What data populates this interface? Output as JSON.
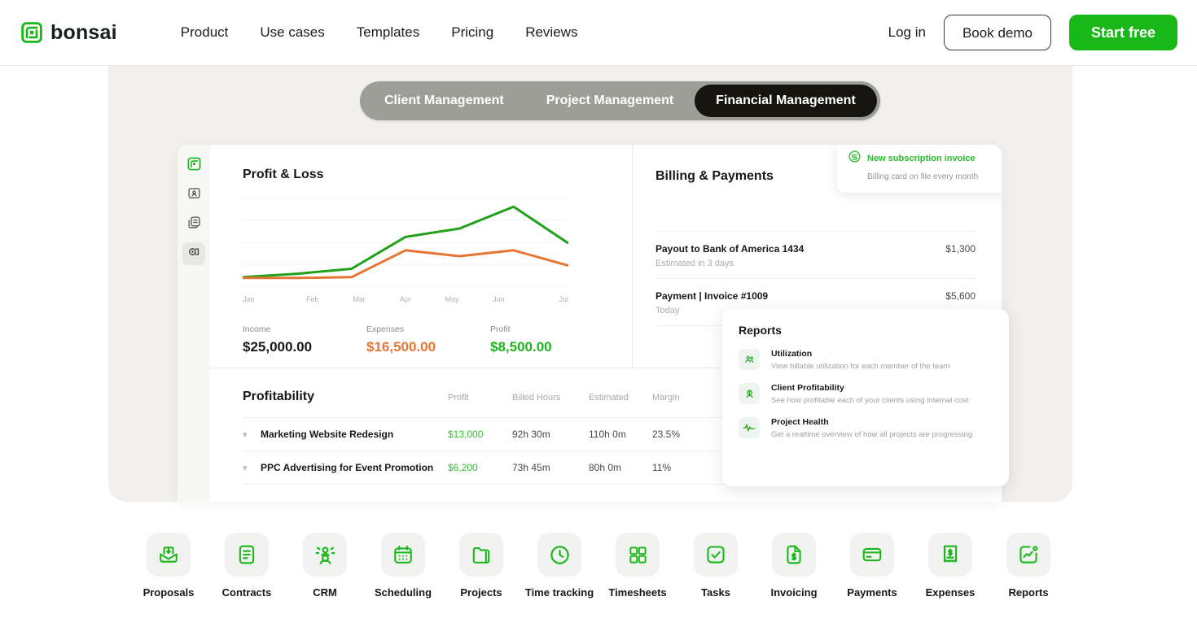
{
  "nav": {
    "brand": "bonsai",
    "brand_icon": "bonsai-square-spiral-logo",
    "links": [
      "Product",
      "Use cases",
      "Templates",
      "Pricing",
      "Reviews"
    ],
    "login": "Log in",
    "book_demo": "Book demo",
    "start_free": "Start free"
  },
  "tabs": [
    {
      "label": "Client Management",
      "active": false
    },
    {
      "label": "Project Management",
      "active": false
    },
    {
      "label": "Financial Management",
      "active": true
    }
  ],
  "rail": [
    {
      "icon": "bonsai-logo-icon",
      "selected": false
    },
    {
      "icon": "contact-card-icon",
      "selected": false
    },
    {
      "icon": "documents-icon",
      "selected": false
    },
    {
      "icon": "payments-icon",
      "selected": true
    }
  ],
  "profit_loss": {
    "title": "Profit & Loss",
    "stats": [
      {
        "label": "Income",
        "value": "$25,000.00",
        "color": "#18181a"
      },
      {
        "label": "Expenses",
        "value": "$16,500.00",
        "color": "#e87434"
      },
      {
        "label": "Profit",
        "value": "$8,500.00",
        "color": "#1db71d"
      }
    ]
  },
  "chart_data": {
    "type": "line",
    "title": "Profit & Loss",
    "xlabel": "",
    "ylabel": "",
    "grid": true,
    "legend_position": "none",
    "categories": [
      "Jan",
      "Feb",
      "Mar",
      "Apr",
      "May",
      "Jun",
      "Jul"
    ],
    "x": [
      0,
      1,
      2,
      3,
      4,
      5,
      6
    ],
    "ylim": [
      0,
      100
    ],
    "series": [
      {
        "name": "Income",
        "color": "#22a11a",
        "values": [
          8,
          12,
          18,
          56,
          66,
          92,
          49
        ]
      },
      {
        "name": "Expenses",
        "color": "#e87434",
        "values": [
          7,
          7,
          8,
          40,
          33,
          40,
          22
        ]
      }
    ]
  },
  "billing": {
    "title": "Billing & Payments",
    "subscription_card": {
      "icon": "subscription-refresh-icon",
      "title": "New subscription invoice",
      "subtitle": "Billing card on file every month"
    },
    "rows": [
      {
        "title": "Payout to Bank of America 1434",
        "subtitle": "Estimated in 3 days",
        "amount": "$1,300"
      },
      {
        "title": "Payment  |  Invoice #1009",
        "subtitle": "Today",
        "amount": "$5,600"
      }
    ]
  },
  "profitability": {
    "title": "Profitability",
    "columns": [
      "Profit",
      "Billed Hours",
      "Estimated",
      "Margin"
    ],
    "rows": [
      {
        "name": "Marketing Website Redesign",
        "profit": "$13,000",
        "billed_hours": "92h 30m",
        "estimated": "110h 0m",
        "margin": "23.5%"
      },
      {
        "name": "PPC Advertising for Event Promotion",
        "profit": "$6,200",
        "billed_hours": "73h 45m",
        "estimated": "80h 0m",
        "margin": "11%"
      }
    ]
  },
  "reports": {
    "title": "Reports",
    "items": [
      {
        "icon": "team-utilization-icon",
        "name": "Utilization",
        "desc": "View billable utilization for each member of the team"
      },
      {
        "icon": "client-profitability-icon",
        "name": "Client Profitability",
        "desc": "See how profitable each of your clients using internal cost"
      },
      {
        "icon": "project-health-pulse-icon",
        "name": "Project Health",
        "desc": "Get a realtime overview of how all projects are progressing"
      }
    ]
  },
  "features": [
    {
      "label": "Proposals",
      "icon": "proposal-envelope-icon"
    },
    {
      "label": "Contracts",
      "icon": "contract-document-icon"
    },
    {
      "label": "CRM",
      "icon": "people-group-icon"
    },
    {
      "label": "Scheduling",
      "icon": "calendar-icon"
    },
    {
      "label": "Projects",
      "icon": "folder-icon"
    },
    {
      "label": "Time tracking",
      "icon": "clock-icon"
    },
    {
      "label": "Timesheets",
      "icon": "grid-squares-icon"
    },
    {
      "label": "Tasks",
      "icon": "checkbox-check-icon"
    },
    {
      "label": "Invoicing",
      "icon": "invoice-dollar-icon"
    },
    {
      "label": "Payments",
      "icon": "credit-card-icon"
    },
    {
      "label": "Expenses",
      "icon": "receipt-dollar-icon"
    },
    {
      "label": "Reports",
      "icon": "chart-trend-icon"
    }
  ],
  "colors": {
    "brand_green": "#18b818",
    "line_green": "#22a11a",
    "line_orange": "#e87434",
    "panel_gray": "#f1f0ee",
    "tab_bar": "#9e9e99",
    "tab_active": "#15140f"
  }
}
